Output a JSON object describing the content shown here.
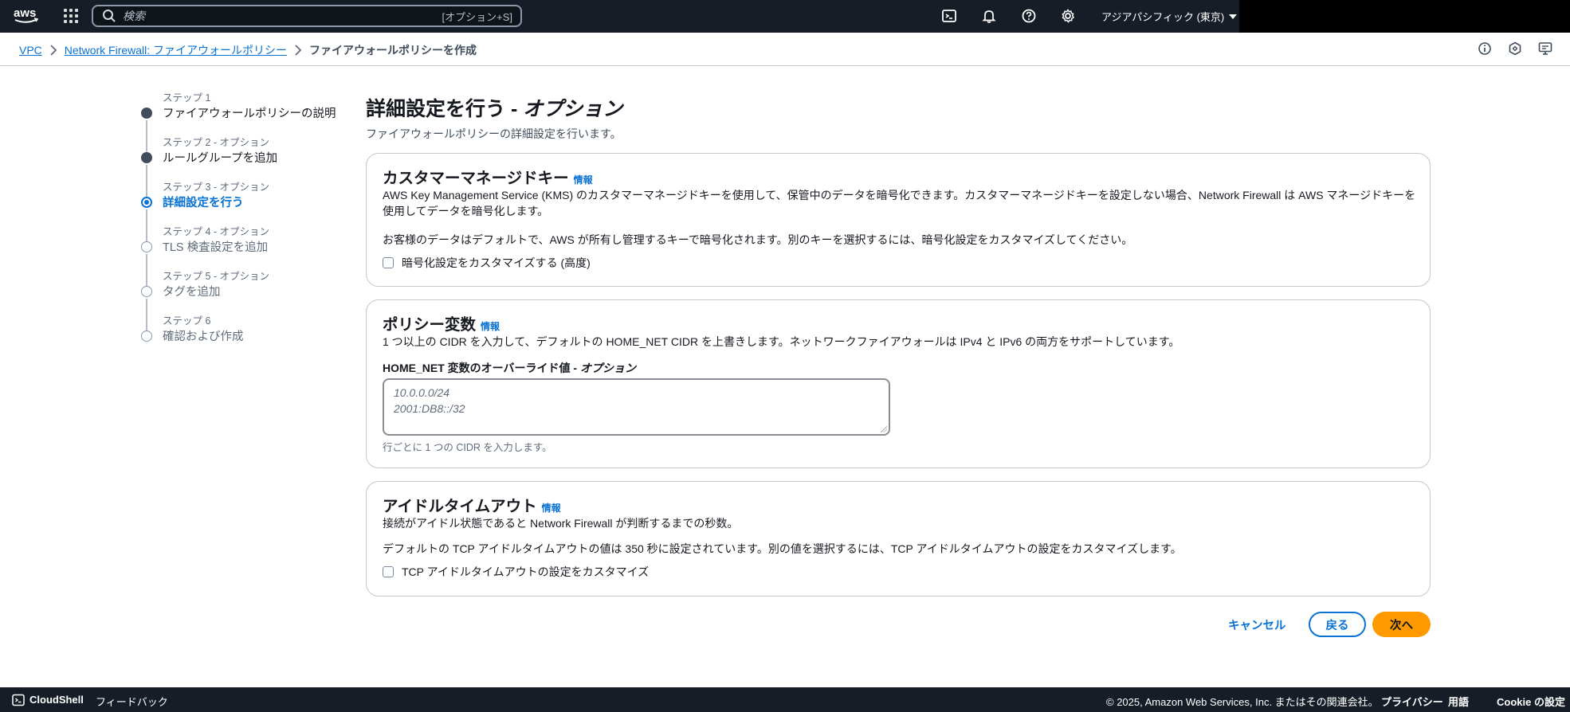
{
  "topnav": {
    "logo_text": "aws",
    "search_placeholder": "検索",
    "search_shortcut": "[オプション+S]",
    "region": "アジアパシフィック (東京)",
    "icons": [
      "services-grid-icon",
      "search-icon",
      "cloudshell-icon",
      "bell-icon",
      "help-icon",
      "gear-icon"
    ]
  },
  "breadcrumb": {
    "items": [
      {
        "label": "VPC"
      },
      {
        "label": "Network Firewall: ファイアウォールポリシー"
      }
    ],
    "current": "ファイアウォールポリシーを作成"
  },
  "steps": [
    {
      "num": "ステップ 1",
      "title": "ファイアウォールポリシーの説明",
      "state": "done"
    },
    {
      "num": "ステップ 2 - オプション",
      "title": "ルールグループを追加",
      "state": "done"
    },
    {
      "num": "ステップ 3 - オプション",
      "title": "詳細設定を行う",
      "state": "active"
    },
    {
      "num": "ステップ 4 - オプション",
      "title": "TLS 検査設定を追加",
      "state": "pending"
    },
    {
      "num": "ステップ 5 - オプション",
      "title": "タグを追加",
      "state": "pending"
    },
    {
      "num": "ステップ 6",
      "title": "確認および作成",
      "state": "pending"
    }
  ],
  "page": {
    "title_main": "詳細設定を行う - ",
    "title_opt": "オプション",
    "description": "ファイアウォールポリシーの詳細設定を行います。"
  },
  "kms": {
    "title": "カスタマーマネージドキー",
    "info": "情報",
    "desc1": "AWS Key Management Service (KMS) のカスタマーマネージドキーを使用して、保管中のデータを暗号化できます。カスタマーマネージドキーを設定しない場合、Network Firewall は AWS マネージドキーを",
    "desc2": "使用してデータを暗号化します。",
    "note": "お客様のデータはデフォルトで、AWS が所有し管理するキーで暗号化されます。別のキーを選択するには、暗号化設定をカスタマイズしてください。",
    "checkbox": "暗号化設定をカスタマイズする (高度)"
  },
  "policy_vars": {
    "title": "ポリシー変数",
    "info": "情報",
    "desc": "1 つ以上の CIDR を入力して、デフォルトの HOME_NET CIDR を上書きします。ネットワークファイアウォールは IPv4 と IPv6 の両方をサポートしています。",
    "label_main": "HOME_NET 変数のオーバーライド値 - ",
    "label_opt": "オプション",
    "placeholder_line1": "10.0.0.0/24",
    "placeholder_line2": "2001:DB8::/32",
    "hint": "行ごとに 1 つの CIDR を入力します。"
  },
  "idle": {
    "title": "アイドルタイムアウト",
    "info": "情報",
    "desc": "接続がアイドル状態であると Network Firewall が判断するまでの秒数。",
    "note": "デフォルトの TCP アイドルタイムアウトの値は 350 秒に設定されています。別の値を選択するには、TCP アイドルタイムアウトの設定をカスタマイズします。",
    "checkbox": "TCP アイドルタイムアウトの設定をカスタマイズ"
  },
  "actions": {
    "cancel": "キャンセル",
    "back": "戻る",
    "next": "次へ"
  },
  "footer": {
    "cloudshell": "CloudShell",
    "feedback": "フィードバック",
    "copyright": "© 2025, Amazon Web Services, Inc. またはその関連会社。",
    "privacy": "プライバシー",
    "terms": "用語",
    "cookie": "Cookie の設定"
  },
  "colors": {
    "nav_bg": "#161d26",
    "link": "#0972d3",
    "primary_button": "#ff9900"
  }
}
